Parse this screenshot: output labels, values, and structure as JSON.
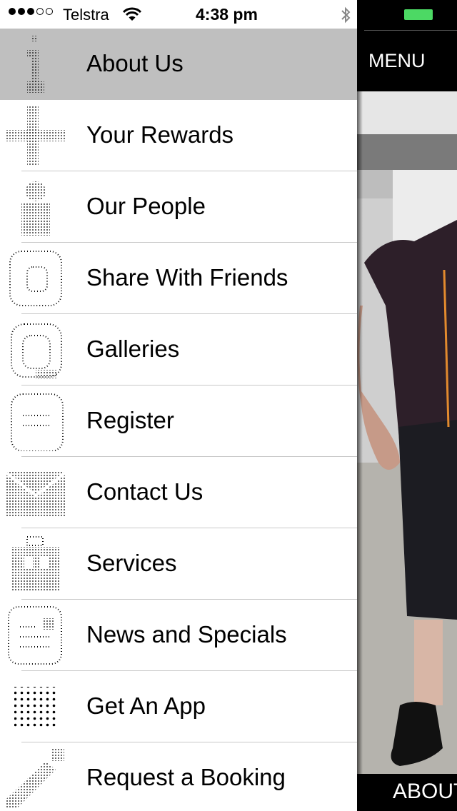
{
  "status_bar": {
    "carrier": "Telstra",
    "time": "4:38 pm",
    "signal_bars_filled": 3,
    "signal_bars_total": 5
  },
  "menu": {
    "items": [
      {
        "label": "About Us",
        "icon": "info-icon",
        "active": true
      },
      {
        "label": "Your Rewards",
        "icon": "plus-icon",
        "active": false
      },
      {
        "label": "Our People",
        "icon": "person-icon",
        "active": false
      },
      {
        "label": "Share With Friends",
        "icon": "at-sign-icon",
        "active": false
      },
      {
        "label": "Galleries",
        "icon": "camera-icon",
        "active": false
      },
      {
        "label": "Register",
        "icon": "form-icon",
        "active": false
      },
      {
        "label": "Contact Us",
        "icon": "envelope-icon",
        "active": false
      },
      {
        "label": "Services",
        "icon": "toolbox-icon",
        "active": false
      },
      {
        "label": "News and Specials",
        "icon": "newspaper-icon",
        "active": false
      },
      {
        "label": "Get An App",
        "icon": "grid-icon",
        "active": false
      },
      {
        "label": "Request a Booking",
        "icon": "pencil-icon",
        "active": false
      }
    ]
  },
  "right_panel": {
    "title": "MENU",
    "bottom_label": "ABOUT US"
  },
  "colors": {
    "active_row": "#bfbfbf",
    "battery": "#4cd964",
    "divider": "#c8c8c8"
  }
}
